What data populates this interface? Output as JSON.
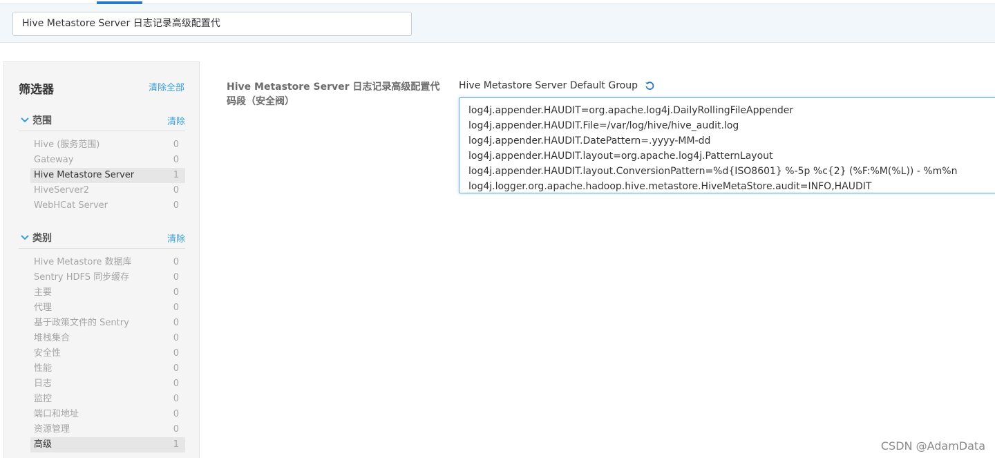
{
  "search": {
    "value": "Hive Metastore Server 日志记录高级配置代"
  },
  "sidebar": {
    "title": "筛选器",
    "clear_all": "清除全部",
    "scope": {
      "title": "范围",
      "clear": "清除",
      "items": [
        {
          "label": "Hive (服务范围)",
          "count": "0",
          "selected": false
        },
        {
          "label": "Gateway",
          "count": "0",
          "selected": false
        },
        {
          "label": "Hive Metastore Server",
          "count": "1",
          "selected": true
        },
        {
          "label": "HiveServer2",
          "count": "0",
          "selected": false
        },
        {
          "label": "WebHCat Server",
          "count": "0",
          "selected": false
        }
      ]
    },
    "category": {
      "title": "类别",
      "clear": "清除",
      "items": [
        {
          "label": "Hive Metastore 数据库",
          "count": "0",
          "selected": false
        },
        {
          "label": "Sentry HDFS 同步缓存",
          "count": "0",
          "selected": false
        },
        {
          "label": "主要",
          "count": "0",
          "selected": false
        },
        {
          "label": "代理",
          "count": "0",
          "selected": false
        },
        {
          "label": "基于政策文件的 Sentry",
          "count": "0",
          "selected": false
        },
        {
          "label": "堆栈集合",
          "count": "0",
          "selected": false
        },
        {
          "label": "安全性",
          "count": "0",
          "selected": false
        },
        {
          "label": "性能",
          "count": "0",
          "selected": false
        },
        {
          "label": "日志",
          "count": "0",
          "selected": false
        },
        {
          "label": "监控",
          "count": "0",
          "selected": false
        },
        {
          "label": "端口和地址",
          "count": "0",
          "selected": false
        },
        {
          "label": "资源管理",
          "count": "0",
          "selected": false
        },
        {
          "label": "高级",
          "count": "1",
          "selected": true
        }
      ]
    }
  },
  "property": {
    "label": "Hive Metastore Server 日志记录高级配置代码段（安全阀）",
    "group": "Hive Metastore Server Default Group",
    "value_lines": [
      "log4j.appender.HAUDIT=org.apache.log4j.DailyRollingFileAppender",
      "log4j.appender.HAUDIT.File=/var/log/hive/hive_audit.log",
      "log4j.appender.HAUDIT.DatePattern=.yyyy-MM-dd",
      "log4j.appender.HAUDIT.layout=org.apache.log4j.PatternLayout",
      "log4j.appender.HAUDIT.layout.ConversionPattern=%d{ISO8601} %-5p %c{2} (%F:%M(%L)) - %m%n",
      "log4j.logger.org.apache.hadoop.hive.metastore.HiveMetaStore.audit=INFO,HAUDIT"
    ]
  },
  "watermark": "CSDN @AdamData",
  "colors": {
    "accent": "#3a9fd8",
    "focus_border": "#66afe9",
    "tab_indicator": "#2b78c5"
  }
}
